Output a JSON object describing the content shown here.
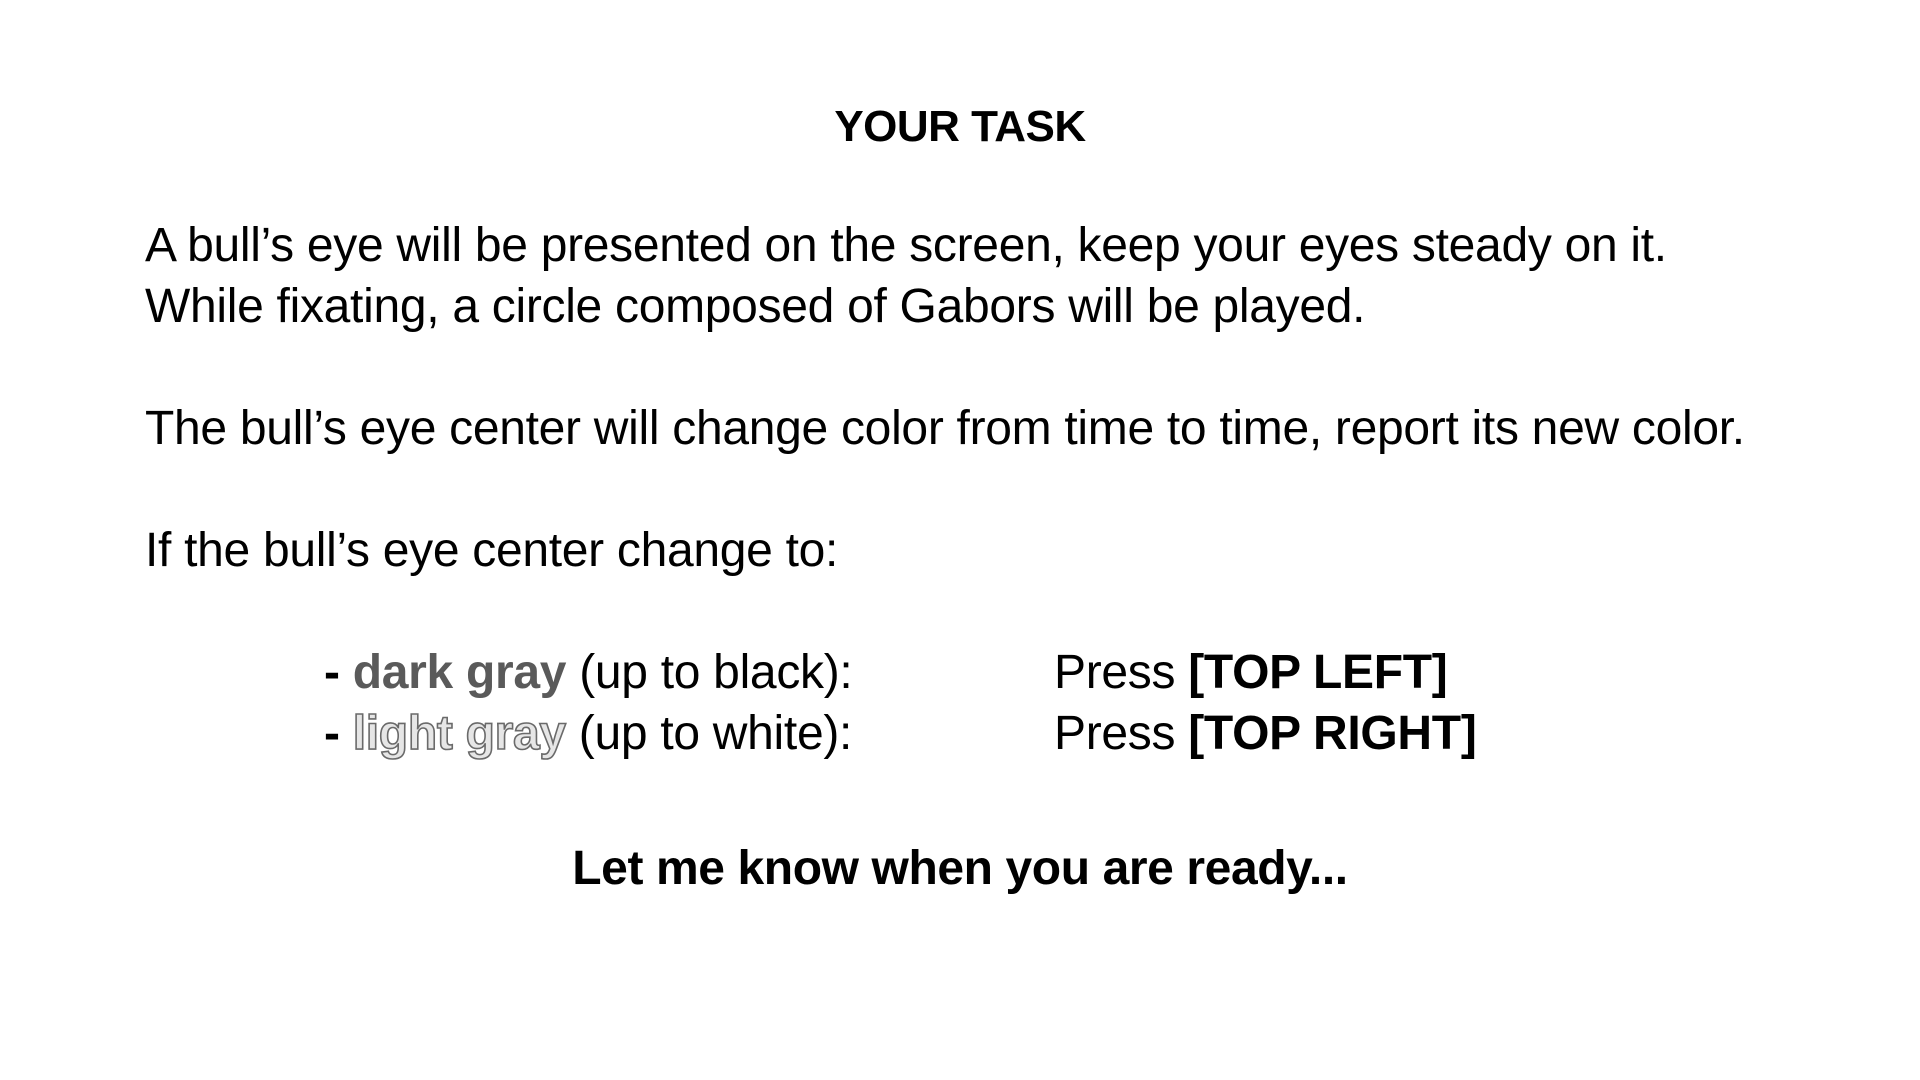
{
  "title": "YOUR TASK",
  "intro": {
    "line1": "A bull’s eye will be presented on the screen, keep your eyes steady on it.",
    "line2": "While fixating, a circle composed of Gabors will be played."
  },
  "report_instruction": "The bull’s eye center will change color from time to time, report its new color.",
  "condition_intro": "If the bull’s eye center change to:",
  "options": [
    {
      "dash": "-",
      "color_word": "dark gray",
      "range": " (up to black):",
      "press_label": "Press ",
      "key": "[TOP LEFT]"
    },
    {
      "dash": "-",
      "color_word": "light gray",
      "range": " (up to white):",
      "press_label": "Press ",
      "key": "[TOP RIGHT]"
    }
  ],
  "ready_prompt": "Let me know when you are ready...",
  "colors": {
    "dark_gray_text": "#5a5a5a",
    "light_gray_fill": "#e6e6e6",
    "light_gray_outline": "#6a6a6a"
  }
}
